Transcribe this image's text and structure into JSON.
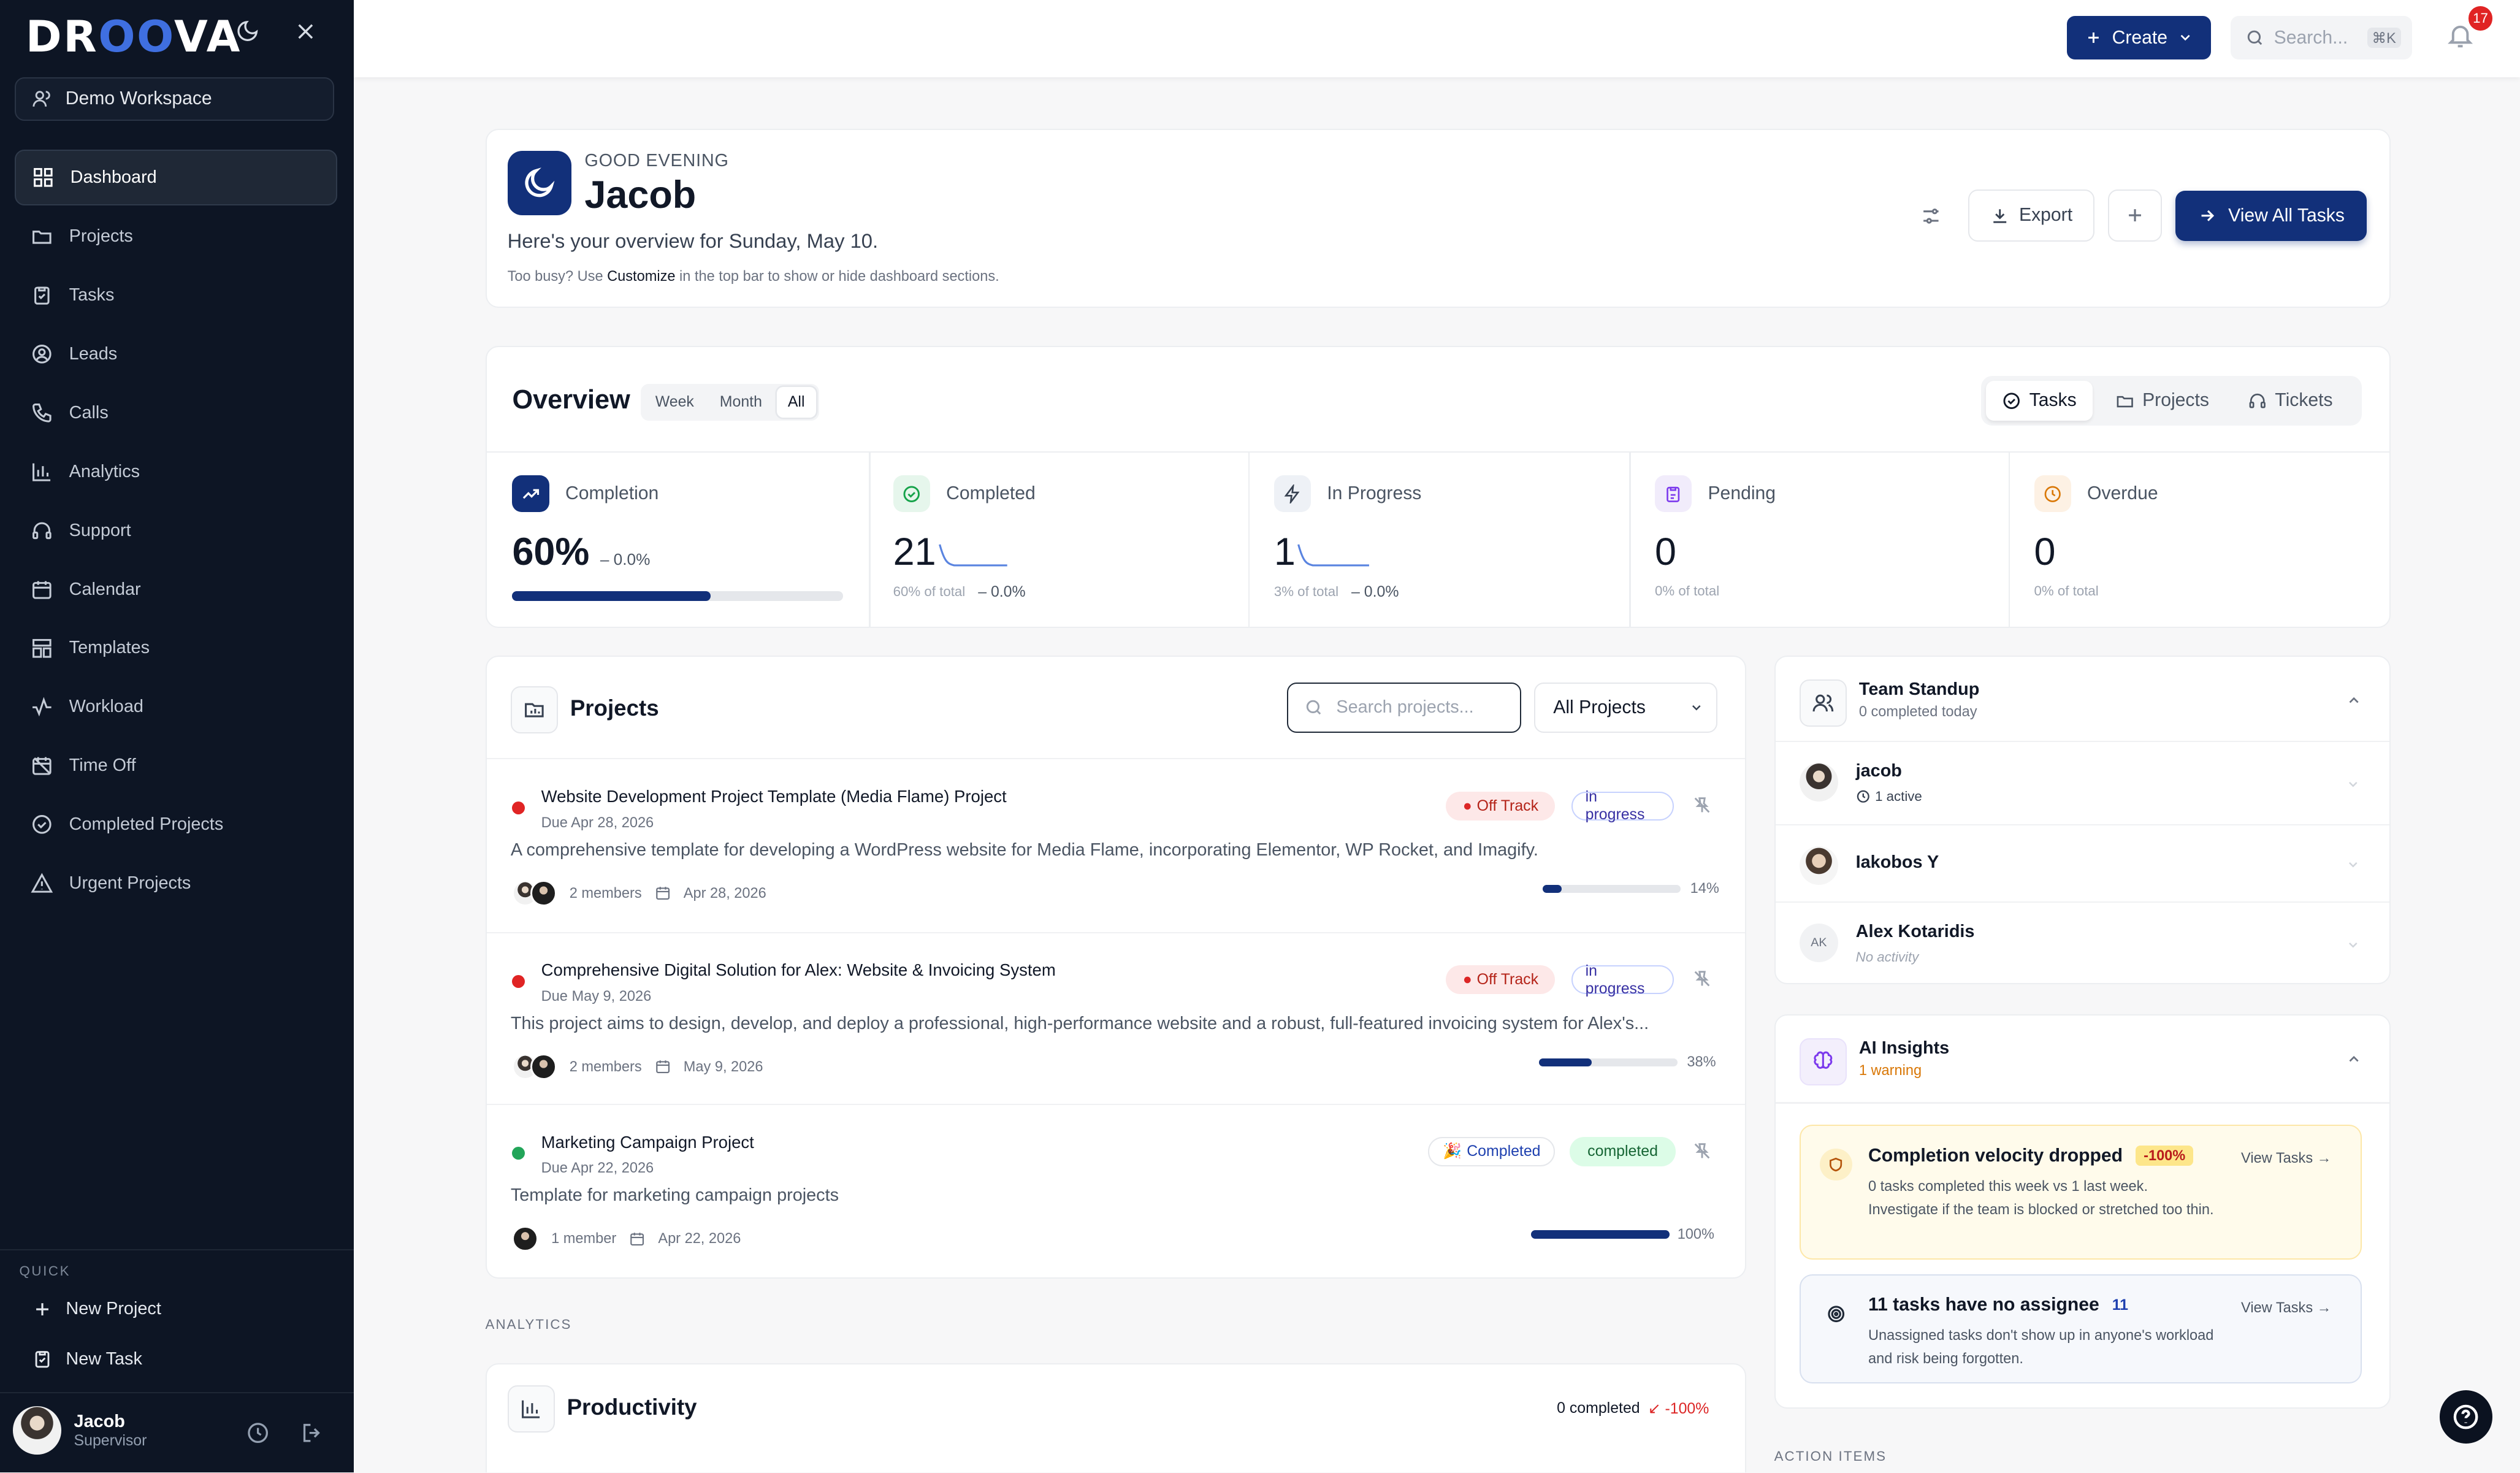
{
  "app": {
    "logo_prefix": "DR",
    "logo_mid": "OO",
    "logo_suffix": "VA",
    "workspace": "Demo Workspace"
  },
  "sidebar": {
    "items": [
      {
        "label": "Dashboard",
        "icon": "grid-icon",
        "active": true
      },
      {
        "label": "Projects",
        "icon": "folder-icon"
      },
      {
        "label": "Tasks",
        "icon": "clipboard-check-icon"
      },
      {
        "label": "Leads",
        "icon": "user-circle-icon"
      },
      {
        "label": "Calls",
        "icon": "phone-icon"
      },
      {
        "label": "Analytics",
        "icon": "bar-chart-icon"
      },
      {
        "label": "Support",
        "icon": "headset-icon"
      },
      {
        "label": "Calendar",
        "icon": "calendar-icon"
      },
      {
        "label": "Templates",
        "icon": "template-icon"
      },
      {
        "label": "Workload",
        "icon": "activity-icon"
      },
      {
        "label": "Time Off",
        "icon": "calendar-off-icon"
      },
      {
        "label": "Completed Projects",
        "icon": "check-circle-icon"
      },
      {
        "label": "Urgent Projects",
        "icon": "alert-triangle-icon"
      }
    ],
    "quick_label": "QUICK",
    "quick_new_project": "New Project",
    "quick_new_task": "New Task",
    "user_name": "Jacob",
    "user_role": "Supervisor"
  },
  "topbar": {
    "create_label": "Create",
    "search_placeholder": "Search...",
    "search_shortcut": "⌘K",
    "notification_count": "17"
  },
  "greeting": {
    "salutation": "GOOD EVENING",
    "name": "Jacob",
    "overview_text": "Here's your overview for Sunday, May 10.",
    "tip_prefix": "Too busy? Use ",
    "tip_keyword": "Customize",
    "tip_suffix": " in the top bar to show or hide dashboard sections.",
    "export_label": "Export",
    "view_all_label": "View All Tasks"
  },
  "overview": {
    "title": "Overview",
    "periods": [
      "Week",
      "Month",
      "All"
    ],
    "active_period": "All",
    "tabs": [
      "Tasks",
      "Projects",
      "Tickets"
    ],
    "active_tab": "Tasks",
    "stats": [
      {
        "label": "Completion",
        "value": "60%",
        "change": "0.0%",
        "progress": 0.6
      },
      {
        "label": "Completed",
        "value": "21",
        "sub": "60% of total",
        "change": "0.0%"
      },
      {
        "label": "In Progress",
        "value": "1",
        "sub": "3% of total",
        "change": "0.0%"
      },
      {
        "label": "Pending",
        "value": "0",
        "sub": "0% of total"
      },
      {
        "label": "Overdue",
        "value": "0",
        "sub": "0% of total"
      }
    ]
  },
  "projects": {
    "title": "Projects",
    "search_placeholder": "Search projects...",
    "filter": "All Projects",
    "rows": [
      {
        "name": "Website Development Project Template (Media Flame) Project",
        "due": "Due Apr 28, 2026",
        "description": "A comprehensive template for developing a WordPress website for Media Flame, incorporating Elementor, WP Rocket, and Imagify.",
        "members": "2 members",
        "date": "Apr 28, 2026",
        "health": "Off Track",
        "status": "in progress",
        "progress_label": "14%",
        "progress": 0.14,
        "dot_color": "#e02424"
      },
      {
        "name": "Comprehensive Digital Solution for Alex: Website & Invoicing System",
        "due": "Due May 9, 2026",
        "description": "This project aims to design, develop, and deploy a professional, high-performance website and a robust, full-featured invoicing system for Alex's...",
        "members": "2 members",
        "date": "May 9, 2026",
        "health": "Off Track",
        "status": "in progress",
        "progress_label": "38%",
        "progress": 0.38,
        "dot_color": "#e02424"
      },
      {
        "name": "Marketing Campaign Project",
        "due": "Due Apr 22, 2026",
        "description": "Template for marketing campaign projects",
        "members": "1 member",
        "date": "Apr 22, 2026",
        "health": "Completed",
        "status": "completed",
        "progress_label": "100%",
        "progress": 1.0,
        "dot_color": "#22a559"
      }
    ]
  },
  "analytics": {
    "section_label": "ANALYTICS",
    "productivity_title": "Productivity",
    "completed_label": "0 completed",
    "change": "-100%"
  },
  "standup": {
    "title": "Team Standup",
    "subtitle": "0 completed today",
    "members": [
      {
        "name": "jacob",
        "sub": "1 active"
      },
      {
        "name": "Iakobos Y",
        "sub": ""
      },
      {
        "name": "Alex Kotaridis",
        "initials": "AK",
        "sub": "No activity"
      }
    ]
  },
  "insights": {
    "title": "AI Insights",
    "subtitle": "1 warning",
    "items": [
      {
        "title": "Completion velocity dropped",
        "badge": "-100%",
        "description": "0 tasks completed this week vs 1 last week. Investigate if the team is blocked or stretched too thin.",
        "link": "View Tasks →"
      },
      {
        "title": "11 tasks have no assignee",
        "badge": "11",
        "description": "Unassigned tasks don't show up in anyone's workload and risk being forgotten.",
        "link": "View Tasks →"
      }
    ],
    "action_items_label": "ACTION ITEMS"
  },
  "colors": {
    "brand": "#12307a",
    "sidebar_bg": "#0d1524",
    "danger": "#e02424",
    "success": "#22a559",
    "warning_bg": "#fffbeb"
  }
}
